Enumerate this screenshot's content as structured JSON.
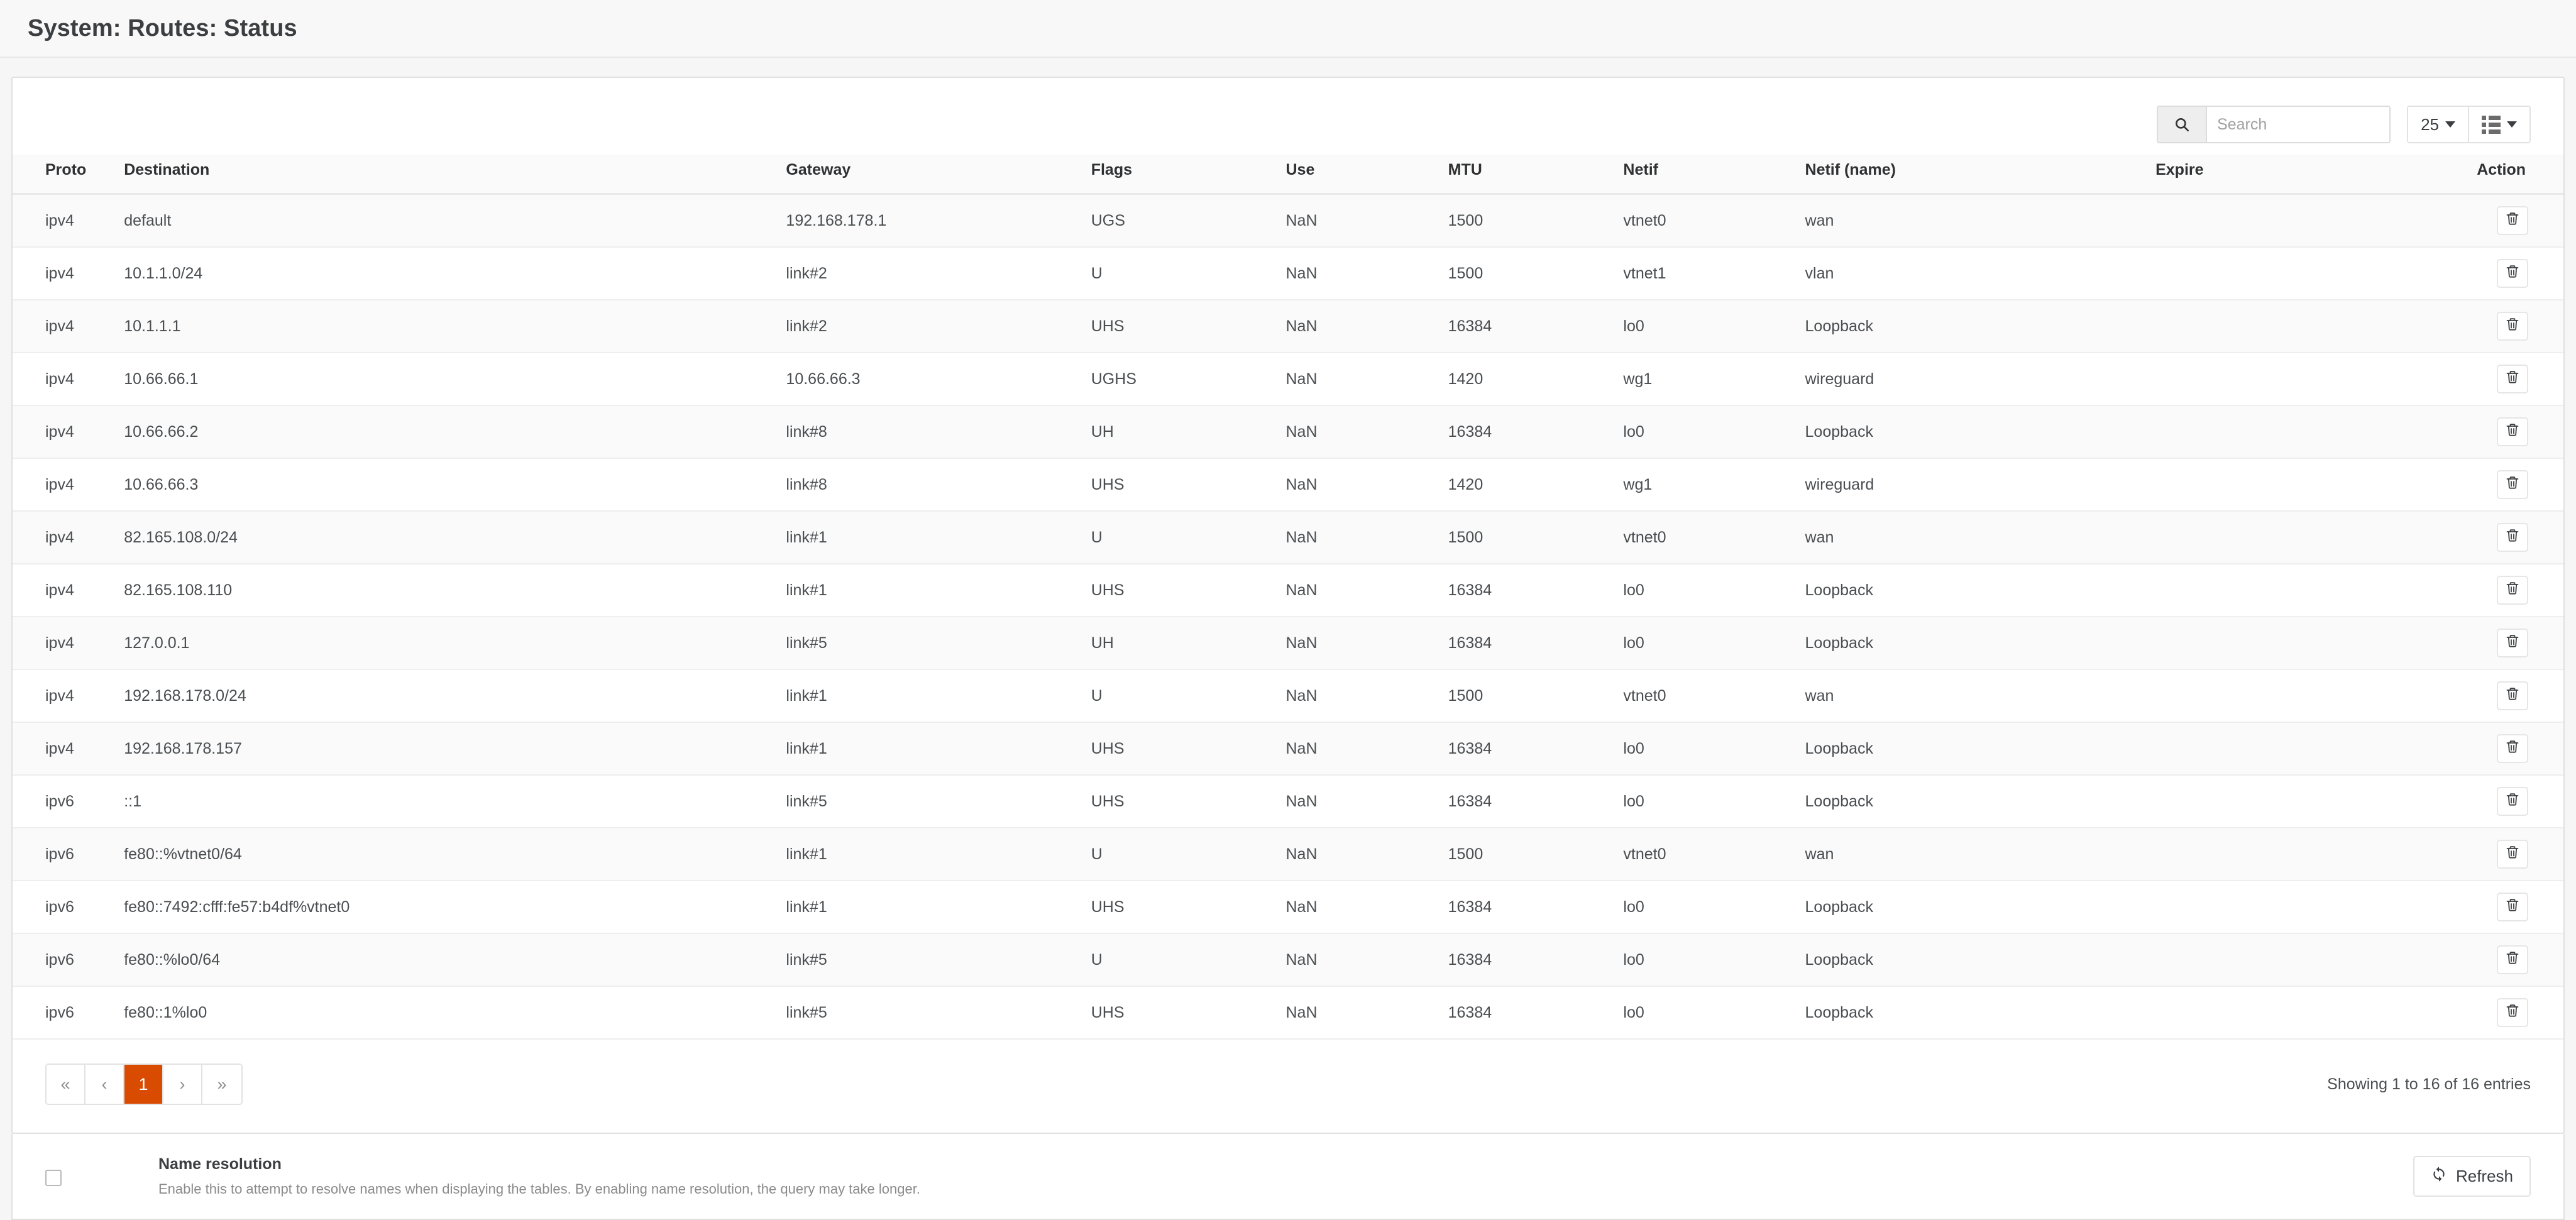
{
  "page": {
    "title": "System: Routes: Status"
  },
  "toolbar": {
    "search_placeholder": "Search",
    "search_value": "",
    "page_size": "25",
    "search_icon": "search-icon",
    "columns_icon": "columns-list-icon"
  },
  "table": {
    "columns": [
      "Proto",
      "Destination",
      "Gateway",
      "Flags",
      "Use",
      "MTU",
      "Netif",
      "Netif (name)",
      "Expire",
      "Action"
    ],
    "rows": [
      {
        "proto": "ipv4",
        "destination": "default",
        "gateway": "192.168.178.1",
        "flags": "UGS",
        "use": "NaN",
        "mtu": "1500",
        "netif": "vtnet0",
        "netif_name": "wan",
        "expire": "",
        "action_icon": "trash-icon"
      },
      {
        "proto": "ipv4",
        "destination": "10.1.1.0/24",
        "gateway": "link#2",
        "flags": "U",
        "use": "NaN",
        "mtu": "1500",
        "netif": "vtnet1",
        "netif_name": "vlan",
        "expire": "",
        "action_icon": "trash-icon"
      },
      {
        "proto": "ipv4",
        "destination": "10.1.1.1",
        "gateway": "link#2",
        "flags": "UHS",
        "use": "NaN",
        "mtu": "16384",
        "netif": "lo0",
        "netif_name": "Loopback",
        "expire": "",
        "action_icon": "trash-icon"
      },
      {
        "proto": "ipv4",
        "destination": "10.66.66.1",
        "gateway": "10.66.66.3",
        "flags": "UGHS",
        "use": "NaN",
        "mtu": "1420",
        "netif": "wg1",
        "netif_name": "wireguard",
        "expire": "",
        "action_icon": "trash-icon"
      },
      {
        "proto": "ipv4",
        "destination": "10.66.66.2",
        "gateway": "link#8",
        "flags": "UH",
        "use": "NaN",
        "mtu": "16384",
        "netif": "lo0",
        "netif_name": "Loopback",
        "expire": "",
        "action_icon": "trash-icon"
      },
      {
        "proto": "ipv4",
        "destination": "10.66.66.3",
        "gateway": "link#8",
        "flags": "UHS",
        "use": "NaN",
        "mtu": "1420",
        "netif": "wg1",
        "netif_name": "wireguard",
        "expire": "",
        "action_icon": "trash-icon"
      },
      {
        "proto": "ipv4",
        "destination": "82.165.108.0/24",
        "gateway": "link#1",
        "flags": "U",
        "use": "NaN",
        "mtu": "1500",
        "netif": "vtnet0",
        "netif_name": "wan",
        "expire": "",
        "action_icon": "trash-icon"
      },
      {
        "proto": "ipv4",
        "destination": "82.165.108.110",
        "gateway": "link#1",
        "flags": "UHS",
        "use": "NaN",
        "mtu": "16384",
        "netif": "lo0",
        "netif_name": "Loopback",
        "expire": "",
        "action_icon": "trash-icon"
      },
      {
        "proto": "ipv4",
        "destination": "127.0.0.1",
        "gateway": "link#5",
        "flags": "UH",
        "use": "NaN",
        "mtu": "16384",
        "netif": "lo0",
        "netif_name": "Loopback",
        "expire": "",
        "action_icon": "trash-icon"
      },
      {
        "proto": "ipv4",
        "destination": "192.168.178.0/24",
        "gateway": "link#1",
        "flags": "U",
        "use": "NaN",
        "mtu": "1500",
        "netif": "vtnet0",
        "netif_name": "wan",
        "expire": "",
        "action_icon": "trash-icon"
      },
      {
        "proto": "ipv4",
        "destination": "192.168.178.157",
        "gateway": "link#1",
        "flags": "UHS",
        "use": "NaN",
        "mtu": "16384",
        "netif": "lo0",
        "netif_name": "Loopback",
        "expire": "",
        "action_icon": "trash-icon"
      },
      {
        "proto": "ipv6",
        "destination": "::1",
        "gateway": "link#5",
        "flags": "UHS",
        "use": "NaN",
        "mtu": "16384",
        "netif": "lo0",
        "netif_name": "Loopback",
        "expire": "",
        "action_icon": "trash-icon"
      },
      {
        "proto": "ipv6",
        "destination": "fe80::%vtnet0/64",
        "gateway": "link#1",
        "flags": "U",
        "use": "NaN",
        "mtu": "1500",
        "netif": "vtnet0",
        "netif_name": "wan",
        "expire": "",
        "action_icon": "trash-icon"
      },
      {
        "proto": "ipv6",
        "destination": "fe80::7492:cfff:fe57:b4df%vtnet0",
        "gateway": "link#1",
        "flags": "UHS",
        "use": "NaN",
        "mtu": "16384",
        "netif": "lo0",
        "netif_name": "Loopback",
        "expire": "",
        "action_icon": "trash-icon"
      },
      {
        "proto": "ipv6",
        "destination": "fe80::%lo0/64",
        "gateway": "link#5",
        "flags": "U",
        "use": "NaN",
        "mtu": "16384",
        "netif": "lo0",
        "netif_name": "Loopback",
        "expire": "",
        "action_icon": "trash-icon"
      },
      {
        "proto": "ipv6",
        "destination": "fe80::1%lo0",
        "gateway": "link#5",
        "flags": "UHS",
        "use": "NaN",
        "mtu": "16384",
        "netif": "lo0",
        "netif_name": "Loopback",
        "expire": "",
        "action_icon": "trash-icon"
      }
    ]
  },
  "pagination": {
    "first": "«",
    "prev": "‹",
    "pages": [
      "1"
    ],
    "active_page": "1",
    "next": "›",
    "last": "»",
    "showing": "Showing 1 to 16 of 16 entries"
  },
  "footer": {
    "name_resolution_label": "Name resolution",
    "name_resolution_description": "Enable this to attempt to resolve names when displaying the tables. By enabling name resolution, the query may take longer.",
    "name_resolution_checked": false,
    "refresh_label": "Refresh",
    "refresh_icon": "refresh-icon"
  },
  "colors": {
    "accent": "#d94b00",
    "page_bg": "#f6f6f6",
    "card_bg": "#ffffff",
    "row_stripe": "#fafafa",
    "border": "#e0e0e0",
    "text": "#3b3f42",
    "muted": "#8b8b8b"
  }
}
